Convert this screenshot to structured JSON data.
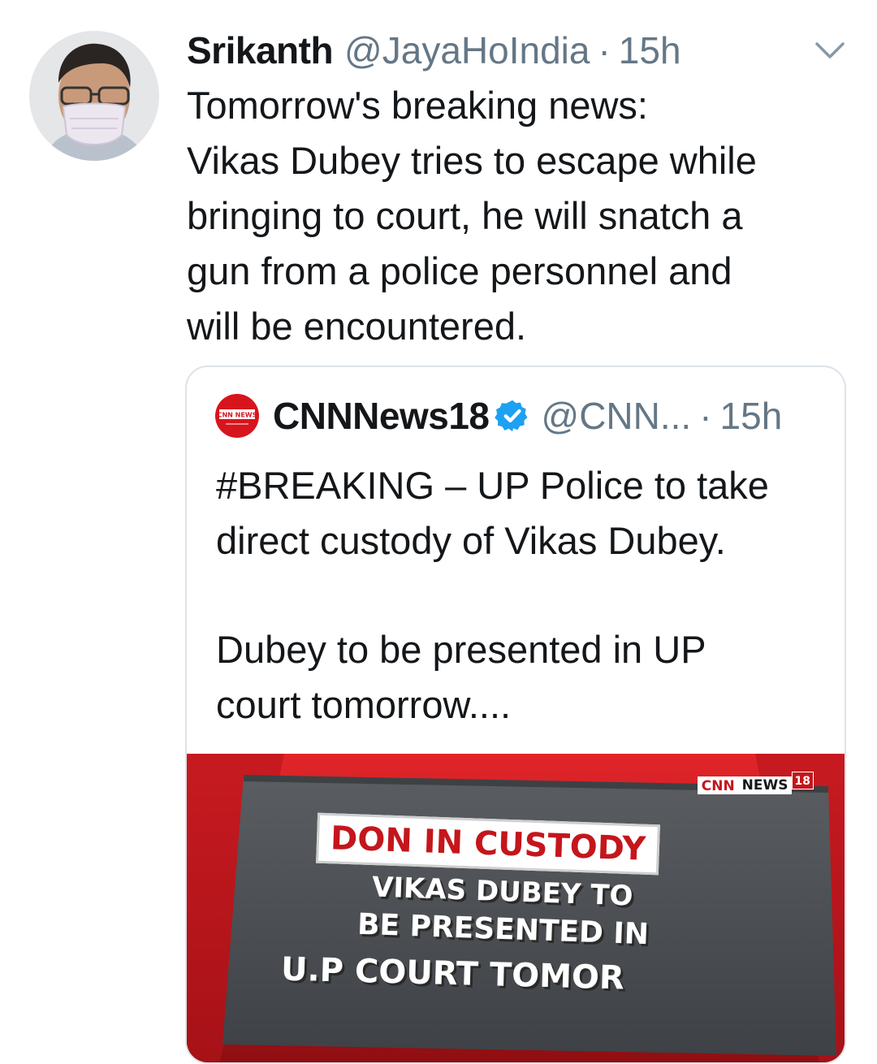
{
  "tweet": {
    "author_name": "Srikanth",
    "author_handle": "@JayaHoIndia",
    "separator": "·",
    "time": "15h",
    "text_lines": [
      "Tomorrow's breaking news:",
      "Vikas Dubey tries to escape while",
      "bringing to court, he will snatch a",
      "gun from a police personnel and",
      "will be encountered."
    ]
  },
  "quoted": {
    "author_name": "CNNNews18",
    "author_handle": "@CNN...",
    "separator": "·",
    "time": "15h",
    "logo_text": "CNN NEWS",
    "paragraph1_lines": [
      "#BREAKING – UP Police to take",
      "direct custody of Vikas Dubey."
    ],
    "paragraph2_lines": [
      "Dubey to be presented in UP",
      "court tomorrow...."
    ],
    "media": {
      "brand_cnn": "CNN",
      "brand_news": "NEWS",
      "brand_num": "18",
      "banner": "DON IN CUSTODY",
      "lines": [
        "VIKAS DUBEY TO",
        "BE PRESENTED IN",
        "U.P COURT TOMOR"
      ]
    }
  },
  "icons": {
    "caret": "chevron-down-icon",
    "verified": "verified-badge-icon"
  },
  "colors": {
    "secondary_text": "#657786",
    "verified": "#1da1f2",
    "brand_red": "#c4161c"
  }
}
